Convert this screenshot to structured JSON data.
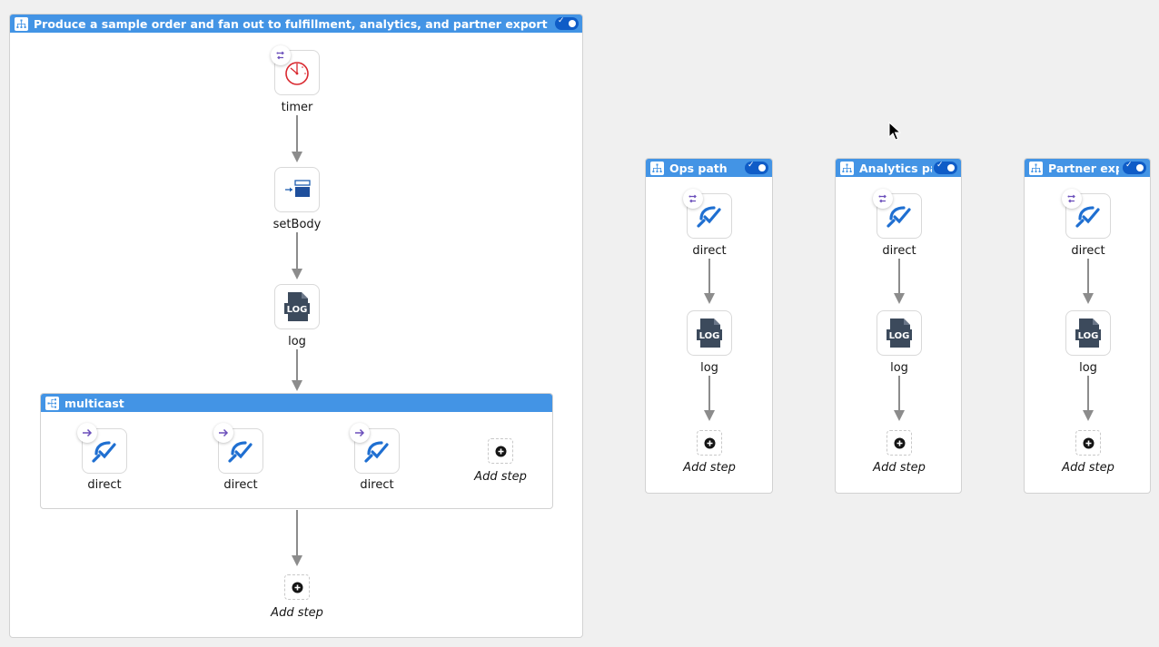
{
  "main_route": {
    "title": "Produce a sample order and fan out to fulfillment, analytics, and partner export",
    "steps": [
      {
        "label": "timer",
        "icon": "timer-icon"
      },
      {
        "label": "setBody",
        "icon": "set-body-icon"
      },
      {
        "label": "log",
        "icon": "log-icon"
      }
    ],
    "multicast": {
      "title": "multicast",
      "branches": [
        {
          "label": "direct"
        },
        {
          "label": "direct"
        },
        {
          "label": "direct"
        }
      ],
      "add_step_label": "Add step"
    },
    "add_step_label": "Add step"
  },
  "side_routes": [
    {
      "title": "Ops path",
      "steps": [
        {
          "label": "direct"
        },
        {
          "label": "log"
        }
      ],
      "add_step_label": "Add step"
    },
    {
      "title": "Analytics path",
      "steps": [
        {
          "label": "direct"
        },
        {
          "label": "log"
        }
      ],
      "add_step_label": "Add step"
    },
    {
      "title": "Partner export",
      "steps": [
        {
          "label": "direct"
        },
        {
          "label": "log"
        }
      ],
      "add_step_label": "Add step"
    }
  ],
  "colors": {
    "header_blue": "#4394e5",
    "toggle_blue": "#0f5cc7",
    "direct_icon_blue": "#1f6fd1",
    "timer_red": "#d9282f",
    "badge_purple": "#6b4fbb",
    "log_dark": "#3c4a5c"
  },
  "log_icon_text": "LOG"
}
